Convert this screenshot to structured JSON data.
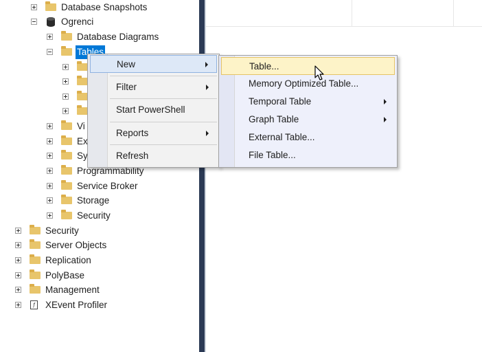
{
  "object_explorer": {
    "nodes": [
      {
        "label": "Database Snapshots",
        "icon": "folder-icon",
        "state": "collapsed"
      },
      {
        "label": "Ogrenci",
        "icon": "database-icon",
        "state": "expanded"
      },
      {
        "label": "Database Diagrams",
        "icon": "folder-icon",
        "state": "collapsed"
      },
      {
        "label": "Tables",
        "icon": "folder-icon",
        "state": "expanded",
        "selected": true
      },
      {
        "label": "Vi",
        "icon": "folder-icon",
        "state": "collapsed"
      },
      {
        "label": "Ex",
        "icon": "folder-icon",
        "state": "collapsed"
      },
      {
        "label": "Sy",
        "icon": "folder-icon",
        "state": "collapsed"
      },
      {
        "label": "Programmability",
        "icon": "folder-icon",
        "state": "collapsed"
      },
      {
        "label": "Service Broker",
        "icon": "folder-icon",
        "state": "collapsed"
      },
      {
        "label": "Storage",
        "icon": "folder-icon",
        "state": "collapsed"
      },
      {
        "label": "Security",
        "icon": "folder-icon",
        "state": "collapsed"
      },
      {
        "label": "Security",
        "icon": "folder-icon",
        "state": "collapsed"
      },
      {
        "label": "Server Objects",
        "icon": "folder-icon",
        "state": "collapsed"
      },
      {
        "label": "Replication",
        "icon": "folder-icon",
        "state": "collapsed"
      },
      {
        "label": "PolyBase",
        "icon": "folder-icon",
        "state": "collapsed"
      },
      {
        "label": "Management",
        "icon": "folder-icon",
        "state": "collapsed"
      },
      {
        "label": "XEvent Profiler",
        "icon": "xevent-icon",
        "state": "collapsed"
      }
    ]
  },
  "context_menu": {
    "items": [
      {
        "label": "New",
        "has_submenu": true,
        "highlighted": true
      },
      {
        "label": "Filter",
        "has_submenu": true
      },
      {
        "label": "Start PowerShell",
        "has_submenu": false
      },
      {
        "label": "Reports",
        "has_submenu": true
      },
      {
        "label": "Refresh",
        "has_submenu": false
      }
    ]
  },
  "new_submenu": {
    "items": [
      {
        "label": "Table...",
        "has_submenu": false,
        "highlighted": true
      },
      {
        "label": "Memory Optimized Table...",
        "has_submenu": false
      },
      {
        "label": "Temporal Table",
        "has_submenu": true
      },
      {
        "label": "Graph Table",
        "has_submenu": true
      },
      {
        "label": "External Table...",
        "has_submenu": false
      },
      {
        "label": "File Table...",
        "has_submenu": false
      }
    ]
  },
  "colors": {
    "selection": "#0078d7",
    "folder": "#e8c56b",
    "splitter": "#2b3a55",
    "menu_background": "#f2f2f2",
    "submenu_highlight": "#fdf3c8"
  }
}
